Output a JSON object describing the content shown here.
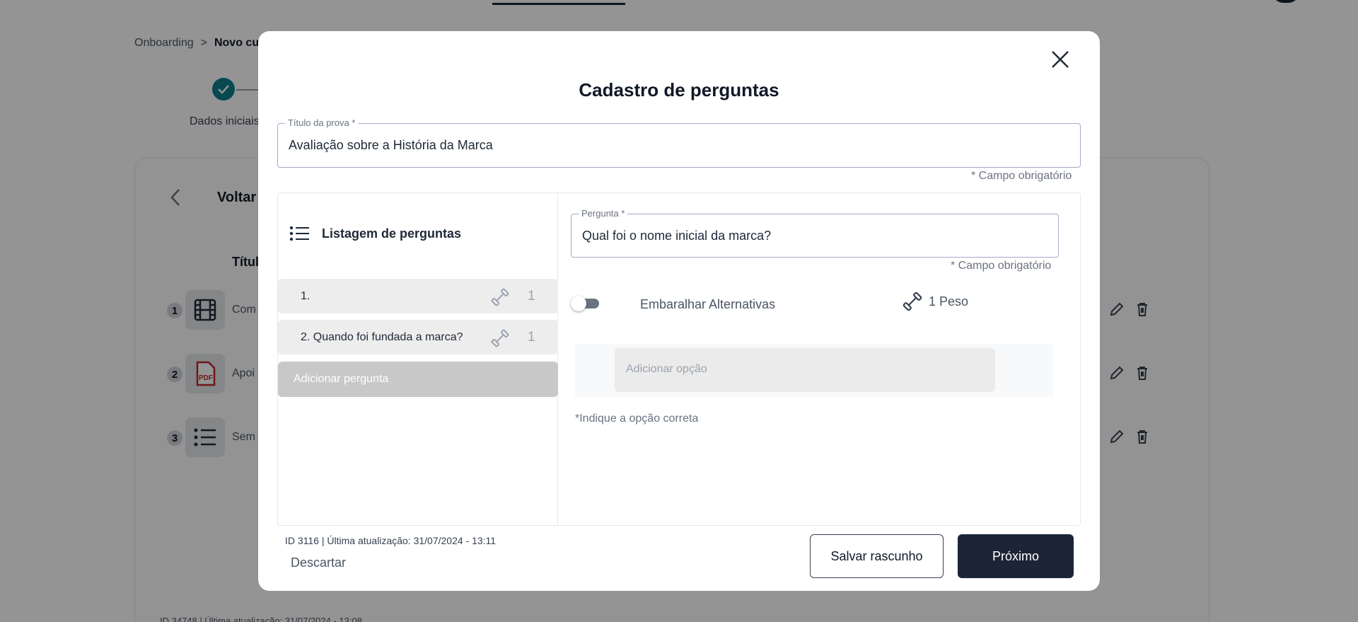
{
  "background": {
    "breadcrumb": {
      "root": "Onboarding",
      "separator": ">",
      "current": "Novo cu"
    },
    "step_label": "Dados iniciais",
    "back_label": "Voltar",
    "column_title": "Títul",
    "rows": [
      {
        "number": "1",
        "icon": "film-icon",
        "text": "Com"
      },
      {
        "number": "2",
        "icon": "pdf-icon",
        "text": "Apoi"
      },
      {
        "number": "3",
        "icon": "list-icon",
        "text": "Sem"
      }
    ],
    "footer": "ID 34748 | Última atualização: 31/07/2024 - 13:08"
  },
  "modal": {
    "title": "Cadastro de perguntas",
    "exam_title_field": {
      "label": "Título da prova *",
      "value": "Avaliação sobre a História da Marca"
    },
    "required_note": "* Campo obrigatório",
    "list": {
      "header": "Listagem de perguntas",
      "questions": [
        {
          "label": "1.",
          "weight": "1"
        },
        {
          "label": "2. Quando foi fundada a marca?",
          "weight": "1"
        }
      ],
      "add_button": "Adicionar pergunta"
    },
    "question_field": {
      "label": "Pergunta *",
      "value": "Qual foi o nome inicial da marca?"
    },
    "shuffle_label": "Embaralhar Alternativas",
    "shuffle_on": false,
    "weight_label": "1 Peso",
    "add_option_placeholder": "Adicionar opção",
    "hint": "*Indique a opção correta",
    "meta": "ID 3116 | Última atualização: 31/07/2024 - 13:11",
    "discard": "Descartar",
    "save_draft": "Salvar rascunho",
    "next": "Próximo"
  },
  "colors": {
    "primary": "#1b2536",
    "step": "#0e7c8c",
    "pdf": "#c0262d"
  }
}
